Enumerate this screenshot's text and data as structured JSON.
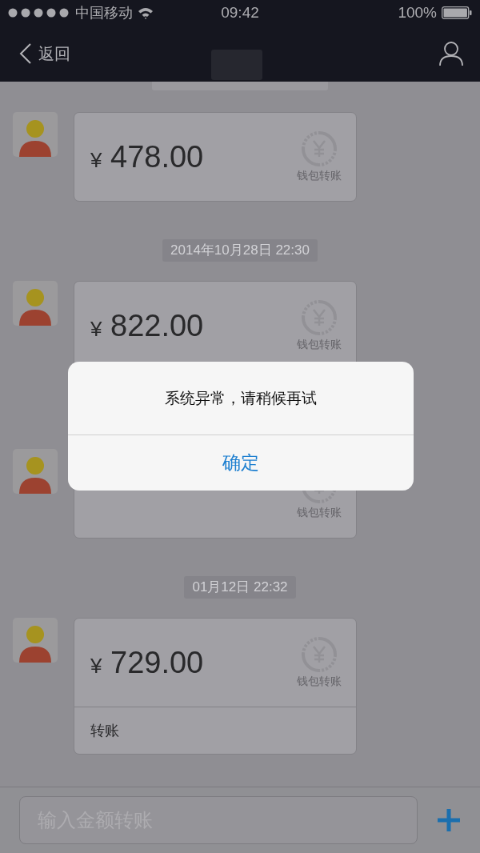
{
  "status_bar": {
    "carrier": "中国移动",
    "time": "09:42",
    "battery": "100%"
  },
  "nav": {
    "back": "返回"
  },
  "messages": [
    {
      "kind": "time_stub"
    },
    {
      "kind": "transfer",
      "currency": "¥",
      "amount": "478.00",
      "badge": "钱包转账"
    },
    {
      "kind": "time",
      "text": "2014年10月28日 22:30"
    },
    {
      "kind": "transfer",
      "currency": "¥",
      "amount": "822.00",
      "badge": "钱包转账"
    },
    {
      "kind": "transfer",
      "badge": "钱包转账"
    },
    {
      "kind": "time",
      "text": "01月12日 22:32"
    },
    {
      "kind": "transfer",
      "currency": "¥",
      "amount": "729.00",
      "badge": "钱包转账",
      "note": "转账"
    }
  ],
  "dialog": {
    "message": "系统异常，请稍候再试",
    "button": "确定"
  },
  "input": {
    "placeholder": "输入金额转账"
  }
}
